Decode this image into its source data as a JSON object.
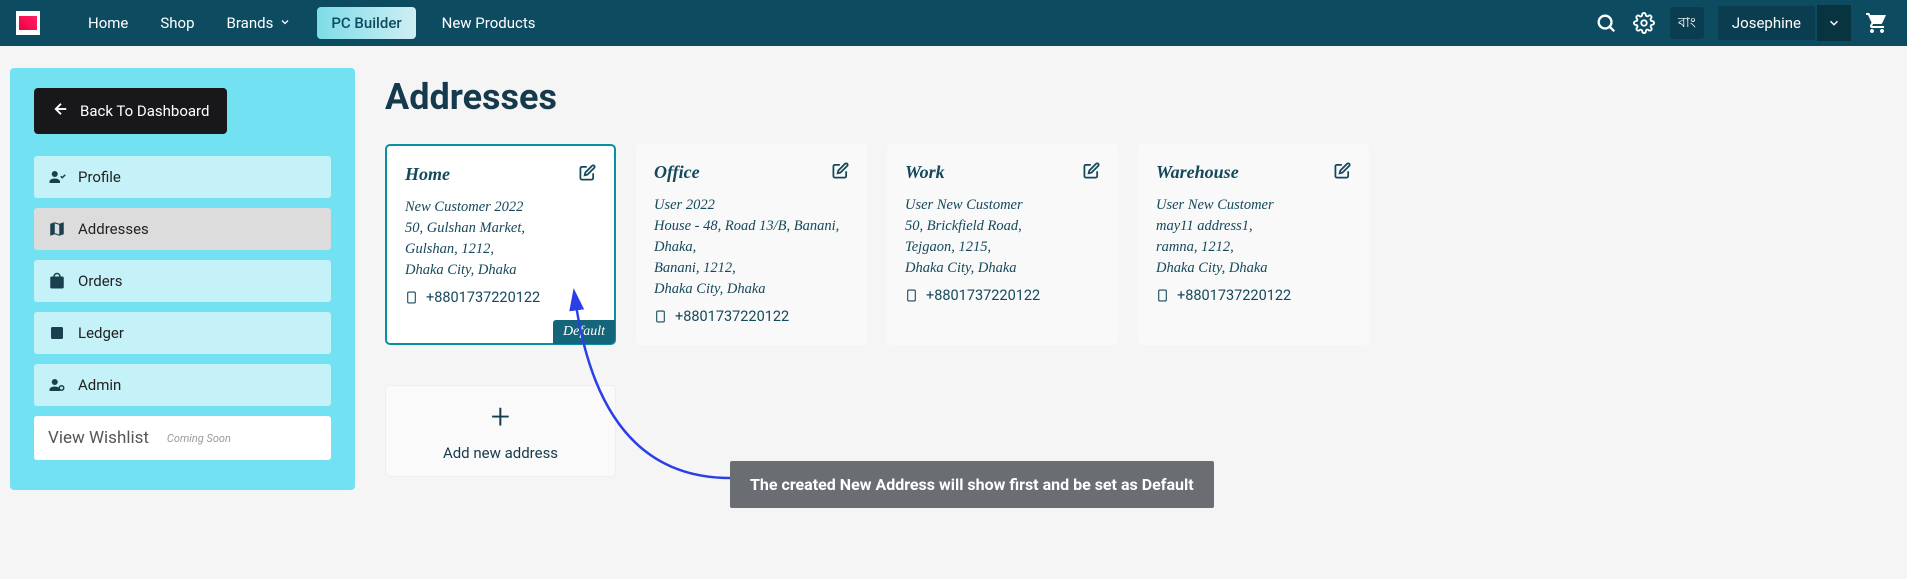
{
  "nav": {
    "items": [
      "Home",
      "Shop",
      "Brands",
      "PC Builder",
      "New Products"
    ],
    "lang": "বাং",
    "user": "Josephine"
  },
  "sidebar": {
    "back_label": "Back To Dashboard",
    "items": [
      {
        "label": "Profile"
      },
      {
        "label": "Addresses"
      },
      {
        "label": "Orders"
      },
      {
        "label": "Ledger"
      },
      {
        "label": "Admin"
      }
    ],
    "wishlist_label": "View Wishlist",
    "coming_soon": "Coming Soon"
  },
  "main": {
    "title": "Addresses",
    "add_new_label": "Add new address"
  },
  "addresses": [
    {
      "title": "Home",
      "lines": [
        "New Customer 2022",
        "50, Gulshan Market,",
        "Gulshan, 1212,",
        "Dhaka City, Dhaka"
      ],
      "phone": "+8801737220122",
      "default": true
    },
    {
      "title": "Office",
      "lines": [
        "User 2022",
        "House - 48, Road 13/B, Banani, Dhaka,",
        "Banani, 1212,",
        "Dhaka City, Dhaka"
      ],
      "phone": "+8801737220122",
      "default": false
    },
    {
      "title": "Work",
      "lines": [
        "User New Customer",
        "50, Brickfield Road,",
        "Tejgaon, 1215,",
        "Dhaka City, Dhaka"
      ],
      "phone": "+8801737220122",
      "default": false
    },
    {
      "title": "Warehouse",
      "lines": [
        "User New Customer",
        "may11 address1,",
        "ramna, 1212,",
        "Dhaka City, Dhaka"
      ],
      "phone": "+8801737220122",
      "default": false
    }
  ],
  "annotation": {
    "text": "The created New Address will show first and be set as Default"
  },
  "default_tag": "Default"
}
